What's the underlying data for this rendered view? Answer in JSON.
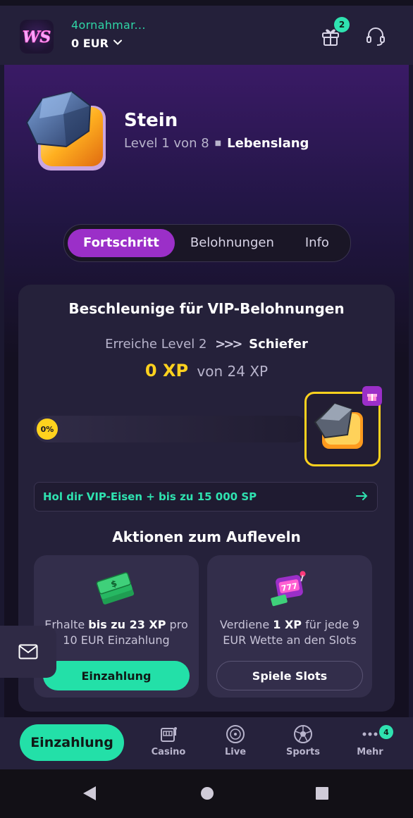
{
  "header": {
    "logo_text": "WS",
    "username": "4ornahmar...",
    "balance": "0 EUR",
    "gift_badge_count": "2"
  },
  "level": {
    "name": "Stein",
    "subtitle": "Level 1 von 8",
    "duration": "Lebenslang"
  },
  "tabs": [
    {
      "label": "Fortschritt",
      "active": true
    },
    {
      "label": "Belohnungen",
      "active": false
    },
    {
      "label": "Info",
      "active": false
    }
  ],
  "progress_card": {
    "title": "Beschleunige für VIP-Belohnungen",
    "reach_prefix": "Erreiche Level 2",
    "next_level_name": "Schiefer",
    "xp_current": "0 XP",
    "xp_total": "von 24 XP",
    "progress_label": "0%",
    "progress_value": 0,
    "promo_text": "Hol dir VIP-Eisen + bis zu 15 000 SP"
  },
  "actions": {
    "title": "Aktionen zum Aufleveln",
    "items": [
      {
        "desc_prefix": "Erhalte ",
        "desc_bold": "bis zu 23 XP",
        "desc_suffix": " pro 10 EUR Einzahlung",
        "button": "Einzahlung"
      },
      {
        "desc_prefix": "Verdiene ",
        "desc_bold": "1 XP",
        "desc_suffix": " für jede 9 EUR Wette an den Slots",
        "button": "Spiele Slots"
      }
    ]
  },
  "bottom_nav": {
    "deposit_label": "Einzahlung",
    "items": [
      {
        "label": "Casino",
        "icon": "slot-machine-icon"
      },
      {
        "label": "Live",
        "icon": "roulette-icon"
      },
      {
        "label": "Sports",
        "icon": "soccer-ball-icon"
      },
      {
        "label": "Mehr",
        "icon": "more-dots-icon"
      }
    ],
    "more_badge_count": "4"
  },
  "colors": {
    "accent_green": "#23e0a8",
    "accent_purple": "#9b2fc8",
    "xp_yellow": "#ffd21e"
  }
}
